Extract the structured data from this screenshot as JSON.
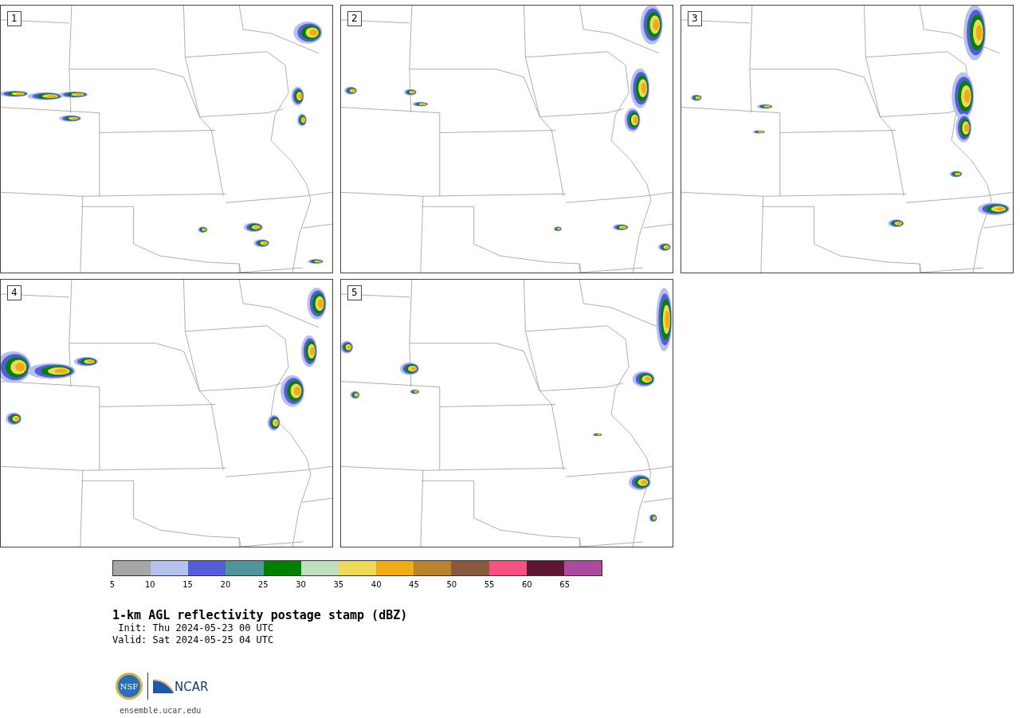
{
  "panels": [
    {
      "label": "1"
    },
    {
      "label": "2"
    },
    {
      "label": "3"
    },
    {
      "label": "4"
    },
    {
      "label": "5"
    }
  ],
  "colorbar": {
    "segments": [
      {
        "color": "#a6a6a6"
      },
      {
        "color": "#b6c1ee"
      },
      {
        "color": "#535ed6"
      },
      {
        "color": "#4f969b"
      },
      {
        "color": "#008000"
      },
      {
        "color": "#bfdfbe"
      },
      {
        "color": "#efd95b"
      },
      {
        "color": "#f0ab18"
      },
      {
        "color": "#bb8330"
      },
      {
        "color": "#8a5a3e"
      },
      {
        "color": "#f65180"
      },
      {
        "color": "#5e1635"
      },
      {
        "color": "#ad4aa0"
      }
    ],
    "ticks": [
      "5",
      "10",
      "15",
      "20",
      "25",
      "30",
      "35",
      "40",
      "45",
      "50",
      "55",
      "60",
      "65"
    ]
  },
  "title": "1-km AGL reflectivity postage stamp (dBZ)",
  "init": " Init: Thu 2024-05-23 00 UTC",
  "valid": "Valid: Sat 2024-05-25 04 UTC",
  "logo": {
    "nsf": "NSF",
    "ncar": "NCAR"
  },
  "url": "ensemble.ucar.edu"
}
